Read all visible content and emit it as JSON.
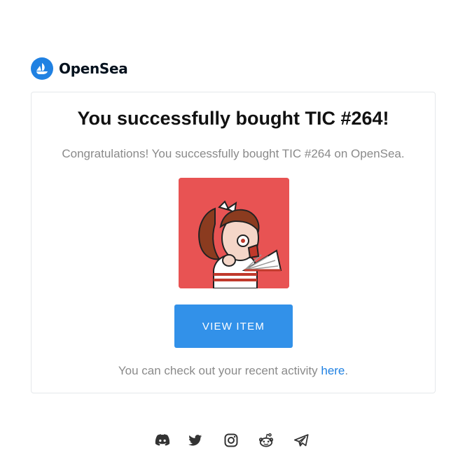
{
  "brand": {
    "name": "OpenSea",
    "color": "#2081e2"
  },
  "email": {
    "title": "You successfully bought TIC #264!",
    "subtitle": "Congratulations! You successfully bought TIC #264 on OpenSea.",
    "button_label": "VIEW ITEM",
    "activity_text": "You can check out your recent activity ",
    "activity_link": "here",
    "activity_suffix": ".",
    "nft_background": "#e85353",
    "button_color": "#3291e9"
  },
  "footer": {
    "socials": [
      {
        "icon": "discord-icon"
      },
      {
        "icon": "twitter-icon"
      },
      {
        "icon": "instagram-icon"
      },
      {
        "icon": "reddit-icon"
      },
      {
        "icon": "telegram-icon"
      }
    ]
  }
}
